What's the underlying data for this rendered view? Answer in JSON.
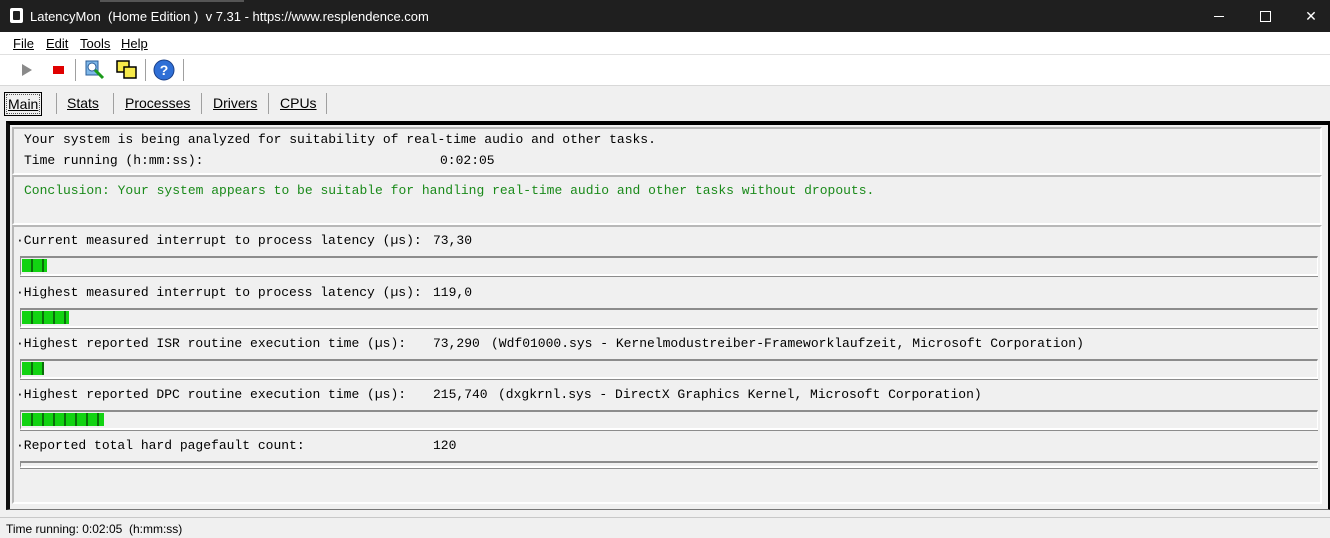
{
  "window": {
    "title": "LatencyMon  (Home Edition )  v 7.31 - https://www.resplendence.com"
  },
  "menu": [
    "File",
    "Edit",
    "Tools",
    "Help"
  ],
  "toolbar": {
    "icons": [
      "play-icon",
      "stop-icon",
      "driver-search-icon",
      "cpu-window-icon",
      "help-icon"
    ]
  },
  "tabs": [
    "Main",
    "Stats",
    "Processes",
    "Drivers",
    "CPUs"
  ],
  "active_tab": "Main",
  "main": {
    "status_line": "Your system is being analyzed for suitability of real-time audio and other tasks.",
    "time_label": "Time running (h:mm:ss):",
    "time_value": "0:02:05",
    "conclusion": "Conclusion: Your system appears to be suitable for handling real-time audio and other tasks without dropouts.",
    "metrics": [
      {
        "label": "·Current measured interrupt to process latency (µs):",
        "value": "73,30",
        "detail": "",
        "bar_fraction": 0.019
      },
      {
        "label": "·Highest measured interrupt to process latency (µs):",
        "value": "119,0",
        "detail": "",
        "bar_fraction": 0.036
      },
      {
        "label": "·Highest reported ISR routine execution time (µs):",
        "value": "73,290",
        "detail": "(Wdf01000.sys - Kernelmodustreiber-Frameworklaufzeit, Microsoft Corporation)",
        "bar_fraction": 0.017
      },
      {
        "label": "·Highest reported DPC routine execution time (µs):",
        "value": "215,740",
        "detail": "(dxgkrnl.sys - DirectX Graphics Kernel, Microsoft Corporation)",
        "bar_fraction": 0.063
      },
      {
        "label": "·Reported total hard pagefault count:",
        "value": "120",
        "detail": "",
        "bar_fraction": 0
      }
    ]
  },
  "status_bar": "Time running: 0:02:05  (h:mm:ss)",
  "colors": {
    "titlebar": "#1f1f1f",
    "conclusion_text": "#1a8a1a",
    "bar_segment": "#12d312"
  }
}
